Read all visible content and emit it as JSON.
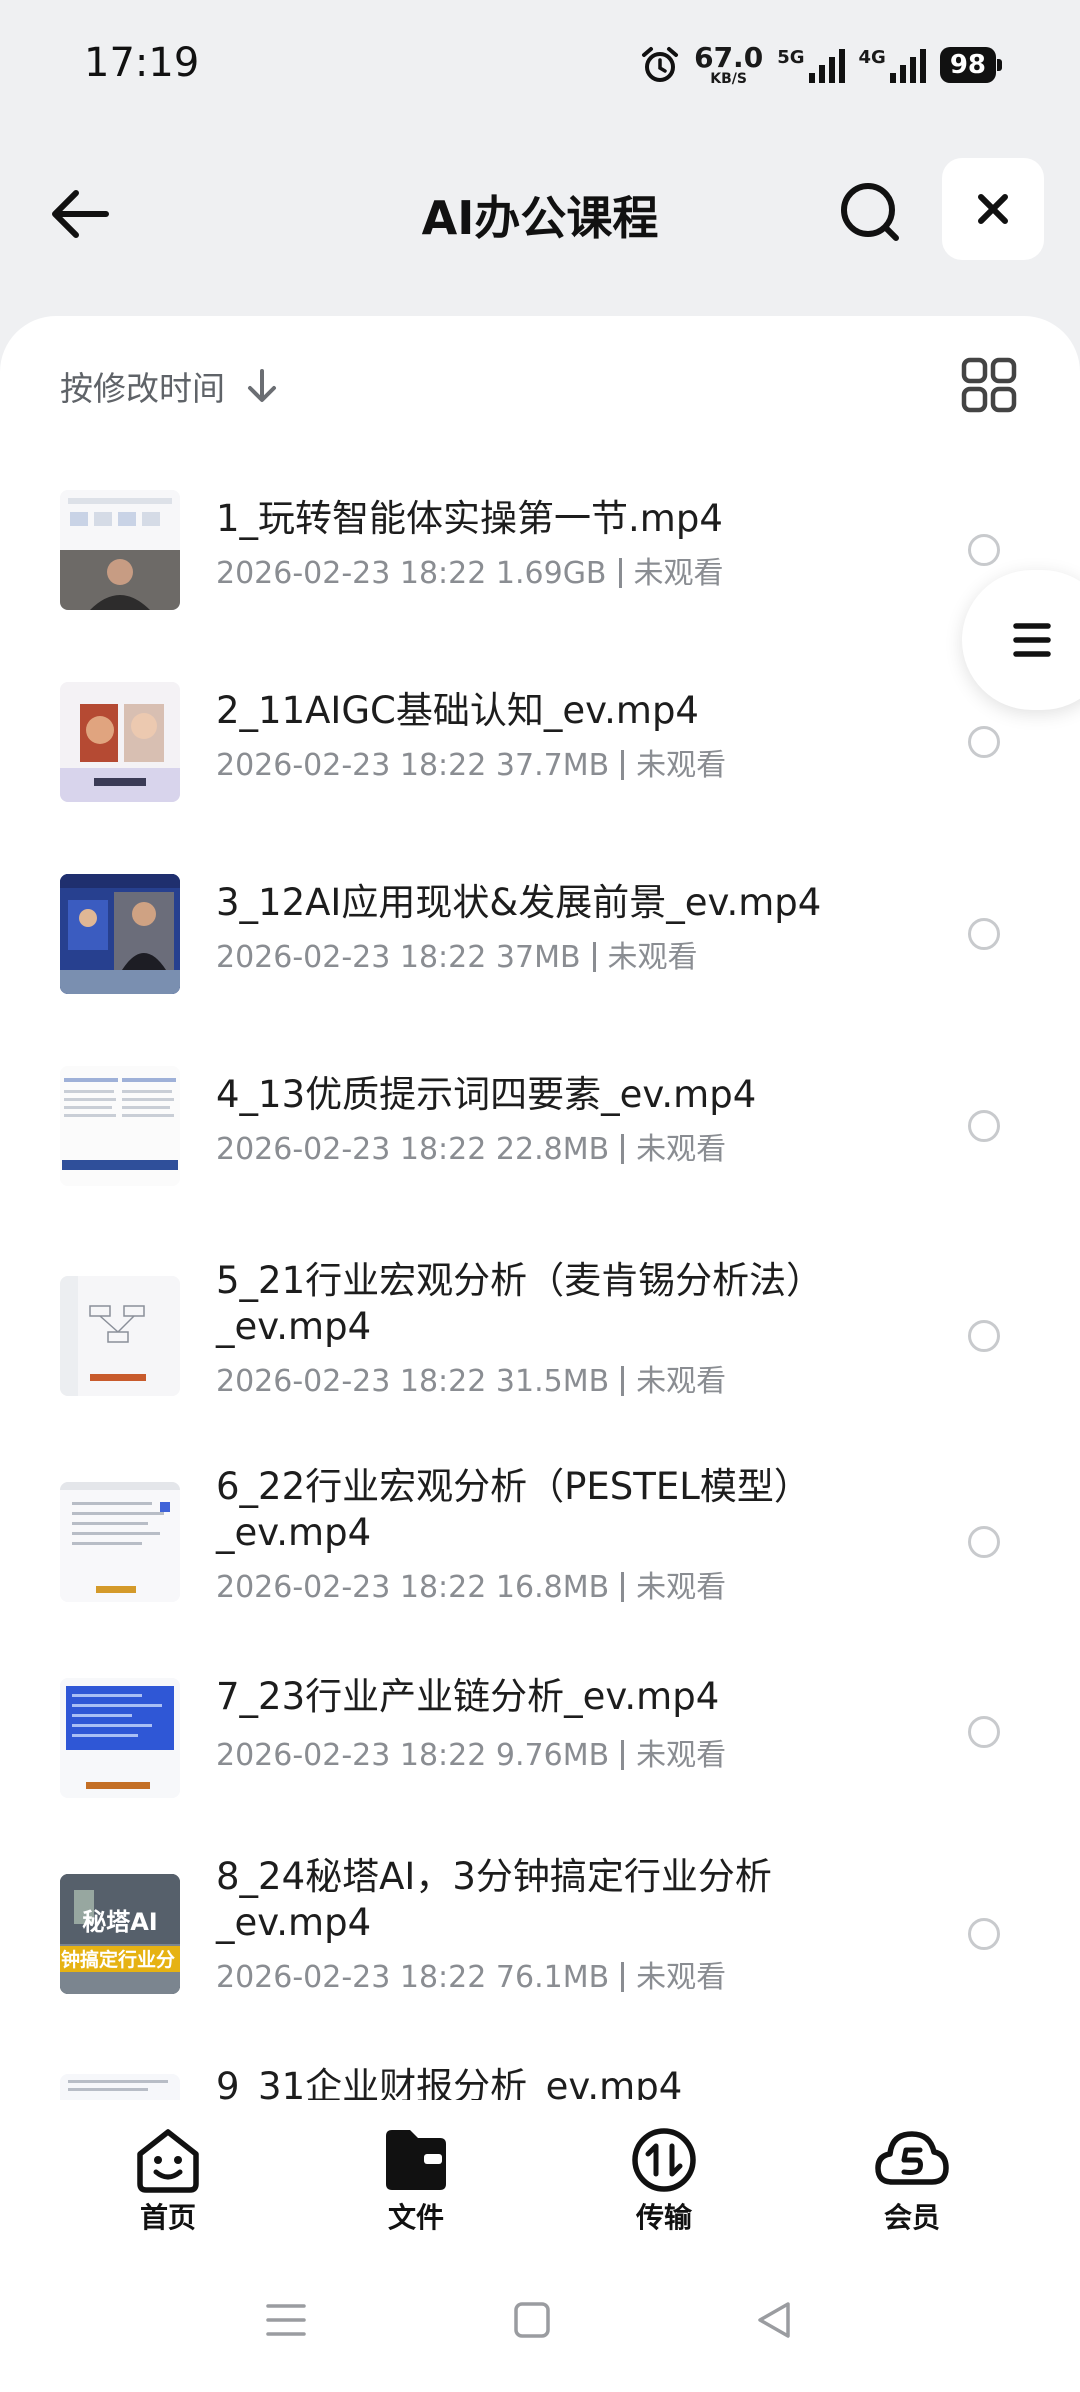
{
  "status_bar": {
    "time": "17:19",
    "speed_value": "67.0",
    "speed_unit": "KB/S",
    "net1_label": "5G",
    "net2_label": "4G",
    "battery": "98"
  },
  "header": {
    "title": "AI办公课程"
  },
  "toolbar": {
    "sort_label": "按修改时间"
  },
  "files": [
    {
      "name": "1_玩转智能体实操第一节.mp4",
      "date": "2026-02-23 18:22",
      "size": "1.69GB",
      "status": "未观看"
    },
    {
      "name": "2_11AIGC基础认知_ev.mp4",
      "date": "2026-02-23 18:22",
      "size": "37.7MB",
      "status": "未观看"
    },
    {
      "name": "3_12AI应用现状&发展前景_ev.mp4",
      "date": "2026-02-23 18:22",
      "size": "37MB",
      "status": "未观看"
    },
    {
      "name": "4_13优质提示词四要素_ev.mp4",
      "date": "2026-02-23 18:22",
      "size": "22.8MB",
      "status": "未观看"
    },
    {
      "name": "5_21行业宏观分析（麦肯锡分析法）_ev.mp4",
      "date": "2026-02-23 18:22",
      "size": "31.5MB",
      "status": "未观看"
    },
    {
      "name": "6_22行业宏观分析（PESTEL模型）_ev.mp4",
      "date": "2026-02-23 18:22",
      "size": "16.8MB",
      "status": "未观看"
    },
    {
      "name": "7_23行业产业链分析_ev.mp4",
      "date": "2026-02-23 18:22",
      "size": "9.76MB",
      "status": "未观看"
    },
    {
      "name": "8_24秘塔AI，3分钟搞定行业分析_ev.mp4",
      "date": "2026-02-23 18:22",
      "size": "76.1MB",
      "status": "未观看"
    },
    {
      "name": "9_31企业财报分析_ev.mp4",
      "date": "",
      "size": "",
      "status": ""
    }
  ],
  "thumb_texts": {
    "t8_line1": "秘塔AI",
    "t8_line2": "钟搞定行业分"
  },
  "bottom_nav": [
    {
      "label": "首页",
      "icon": "home-face-icon"
    },
    {
      "label": "文件",
      "icon": "folder-icon"
    },
    {
      "label": "传输",
      "icon": "transfer-icon"
    },
    {
      "label": "会员",
      "icon": "vip-cloud-icon"
    }
  ],
  "colors": {
    "background": "#eff0f2",
    "sheet": "#ffffff",
    "meta_text": "#8a8d92"
  }
}
